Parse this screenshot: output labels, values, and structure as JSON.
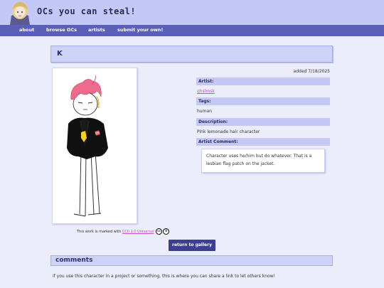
{
  "header": {
    "site_title": "OCs you can steal!"
  },
  "nav": {
    "items": [
      {
        "label": "about"
      },
      {
        "label": "browse OCs"
      },
      {
        "label": "artists"
      },
      {
        "label": "submit your own!"
      }
    ]
  },
  "oc": {
    "name": "K",
    "added": "added 7/18/2025",
    "artist_label": "Artist:",
    "artist": "ghslmsk",
    "tags_label": "Tags:",
    "tags": "human",
    "description_label": "Description:",
    "description": "Pink lemonade hair character",
    "comment_label": "Artist Comment:",
    "comment": "Character uses he/him but do whatever. That is a lesbian flag patch on the jacket."
  },
  "license": {
    "prefix": "This work is marked with",
    "link": "CC0 1.0 Universal",
    "cc_icon": "cc",
    "zero_icon": "0"
  },
  "actions": {
    "return_label": "return to gallery"
  },
  "comments": {
    "title": "comments",
    "info": "if you use this character in a project or something, this is where you can share a link to let others know!"
  },
  "colors": {
    "header_bg": "#c3c8f6",
    "nav_bg": "#5a60b8",
    "page_bg": "#ecedfb",
    "accent": "#3c3f8f",
    "link": "#c850c8",
    "hair": "#f06a8e"
  }
}
